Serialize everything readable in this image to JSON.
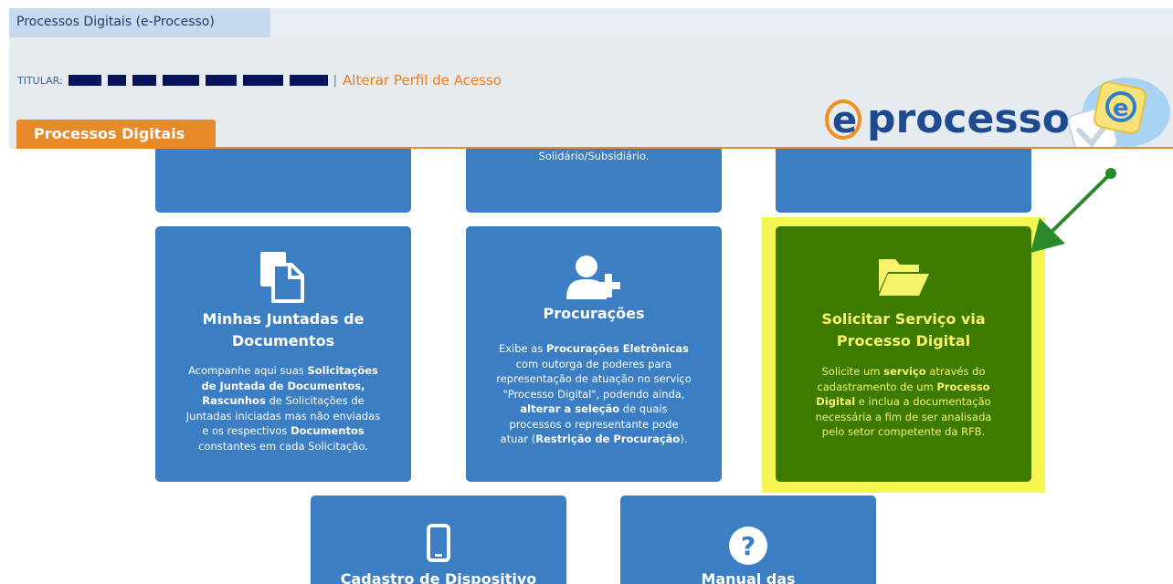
{
  "window": {
    "title": "Processos Digitais (e-Processo)"
  },
  "header": {
    "titular_label": "TITULAR:",
    "alterar_link": "Alterar Perfil de Acesso",
    "separator": "|",
    "logo_text": "e-processo"
  },
  "section_tab": {
    "label": "Processos Digitais"
  },
  "colors": {
    "card_blue": "#3c7ec4",
    "card_green": "#3c7a00",
    "green_text": "#f7f36a",
    "highlight_yellow": "#f4f550",
    "arrow_green": "#2a8a2a",
    "orange_accent": "#e8892a"
  },
  "cards": {
    "top_middle_partial_text": "Solidário/Subsidiário.",
    "juntadas": {
      "icon": "documents-icon",
      "title_line1": "Minhas Juntadas de",
      "title_line2": "Documentos",
      "desc": {
        "l1a": "Acompanhe aqui suas ",
        "l1b": "Solicitações",
        "l2": "de Juntada de Documentos,",
        "l3a": "Rascunhos",
        "l3b": " de Solicitações de",
        "l4": "Juntadas iniciadas mas não enviadas",
        "l5a": "e os respectivos ",
        "l5b": "Documentos",
        "l6": "constantes em cada Solicitação."
      }
    },
    "procuracoes": {
      "icon": "add-user-icon",
      "title": "Procurações",
      "desc": {
        "l1a": "Exibe as ",
        "l1b": "Procurações Eletrônicas",
        "l2": "com outorga de poderes para",
        "l3": "representação de atuação no serviço",
        "l4": "\"Processo Digital\", podendo ainda,",
        "l5a": "alterar a seleção",
        "l5b": " de quais",
        "l6": "processos o representante pode",
        "l7a": "atuar (",
        "l7b": "Restrição de Procuração",
        "l7c": ")."
      }
    },
    "solicitar": {
      "icon": "folder-open-icon",
      "title_line1": "Solicitar Serviço via",
      "title_line2": "Processo Digital",
      "desc": {
        "l1a": "Solicite um ",
        "l1b": "serviço",
        "l1c": " através do",
        "l2a": "cadastramento de um ",
        "l2b": "Processo",
        "l3a": "Digital",
        "l3b": " e inclua a documentação",
        "l4": "necessária a fim de ser analisada",
        "l5": "pelo setor competente da RFB."
      }
    },
    "cadastro": {
      "icon": "mobile-phone-icon",
      "title": "Cadastro de Dispositivo"
    },
    "manual": {
      "icon": "question-icon",
      "title": "Manual das"
    }
  }
}
